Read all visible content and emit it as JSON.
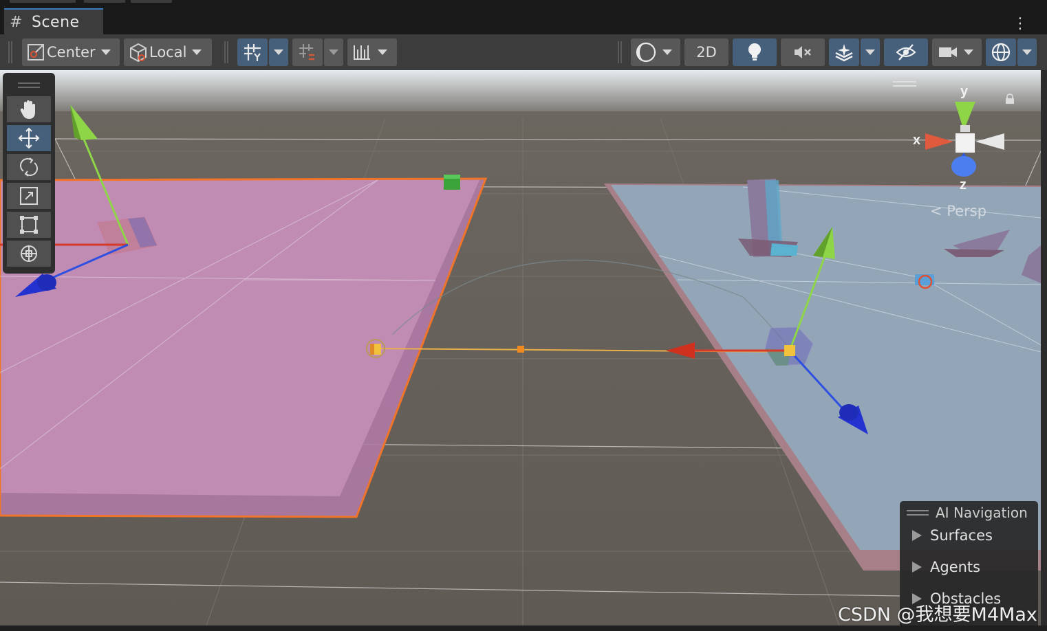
{
  "window": {
    "tab_title": "Scene",
    "tab_icon": "hash-grid-icon",
    "menu_icon": "kebab-menu-icon"
  },
  "toolbar": {
    "pivot_mode": "Center",
    "pivot_rotation": "Local",
    "two_d_label": "2D",
    "active_color": "#46607c"
  },
  "tools": [
    "hand-tool",
    "move-tool",
    "rotate-tool",
    "scale-tool",
    "rect-tool",
    "transform-tool"
  ],
  "active_tool": "move-tool",
  "orientation_gizmo": {
    "x_label": "x",
    "y_label": "y",
    "z_label": "z",
    "projection": "Persp"
  },
  "ai_navigation": {
    "title": "AI Navigation",
    "items": [
      "Surfaces",
      "Agents",
      "Obstacles"
    ]
  },
  "watermark": "CSDN @我想要M4Max",
  "colors": {
    "pink_surface": "#c08cb4",
    "blue_surface": "#93a6b8",
    "ground": "#656059",
    "selection_outline": "#f0742a",
    "x_axis": "#d63a2a",
    "y_axis": "#8ed548",
    "z_axis": "#2f4fe0"
  }
}
